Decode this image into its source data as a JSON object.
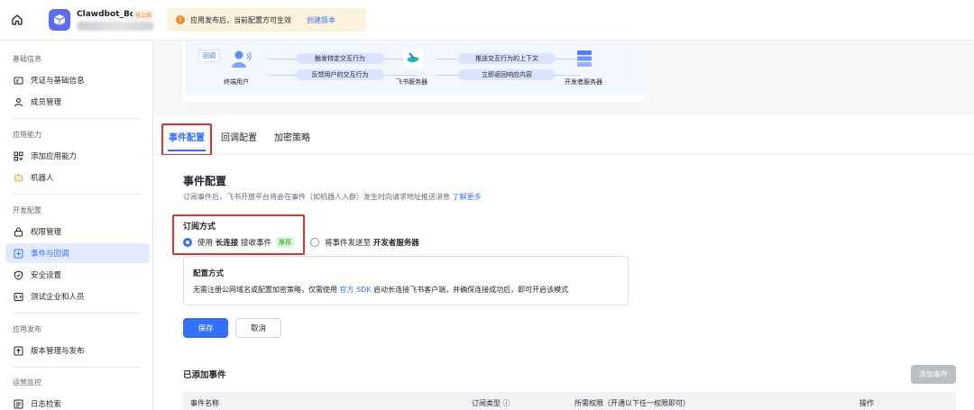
{
  "app": {
    "name": "Clawdbot_Bot",
    "badge": "待上线"
  },
  "notice": {
    "text": "应用发布后，当前配置方可生效",
    "link": "创建版本"
  },
  "sidebar": {
    "sections": [
      {
        "title": "基础信息",
        "items": [
          {
            "label": "凭证与基础信息",
            "icon": "credential-icon"
          },
          {
            "label": "成员管理",
            "icon": "user-icon"
          }
        ]
      },
      {
        "title": "应用能力",
        "items": [
          {
            "label": "添加应用能力",
            "icon": "add-capability-icon"
          },
          {
            "label": "机器人",
            "icon": "robot-icon"
          }
        ]
      },
      {
        "title": "开发配置",
        "items": [
          {
            "label": "权限管理",
            "icon": "lock-icon"
          },
          {
            "label": "事件与回调",
            "icon": "event-icon",
            "active": true
          },
          {
            "label": "安全设置",
            "icon": "shield-icon"
          },
          {
            "label": "测试企业和人员",
            "icon": "code-icon"
          }
        ]
      },
      {
        "title": "应用发布",
        "items": [
          {
            "label": "版本管理与发布",
            "icon": "upload-icon"
          }
        ]
      },
      {
        "title": "运营监控",
        "items": [
          {
            "label": "日志检索",
            "icon": "log-icon"
          }
        ]
      }
    ]
  },
  "diagram": {
    "tag": "回调",
    "user_label": "终端用户",
    "feishu_label": "飞书服务器",
    "dev_label": "开发者服务器",
    "arrow1": "触发特定交互行为",
    "arrow2": "反馈用户的交互行为",
    "arrow3": "推送交互行为的上下文",
    "arrow4": "立即返回响应内容"
  },
  "tabs": [
    "事件配置",
    "回调配置",
    "加密策略"
  ],
  "content": {
    "title": "事件配置",
    "desc": "订阅事件后，飞书开放平台将会在事件（如机器人入群）发生时向请求地址推送消息",
    "desc_link": "了解更多",
    "sub_title": "订阅方式",
    "option1_pre": "使用",
    "option1_bold": "长连接",
    "option1_post": "接收事件",
    "option1_tag": "推荐",
    "option2_pre": "将事件发送至",
    "option2_bold": "开发者服务器",
    "config_title": "配置方式",
    "config_desc_pre": "无需注册公网域名或配置加密策略，仅需使用",
    "config_desc_link": "官方 SDK",
    "config_desc_post": "启动长连接飞书客户端，并确保连接成功后，即可开启该模式",
    "save": "保存",
    "cancel": "取消",
    "added_title": "已添加事件",
    "add_button": "添加事件",
    "table_headers": [
      "事件名称",
      "订阅类型 ⓘ",
      "所需权限（开通以下任一权限即可）",
      "操作"
    ]
  },
  "colors": {
    "accent": "#3370ff",
    "highlight": "#e0322c"
  }
}
